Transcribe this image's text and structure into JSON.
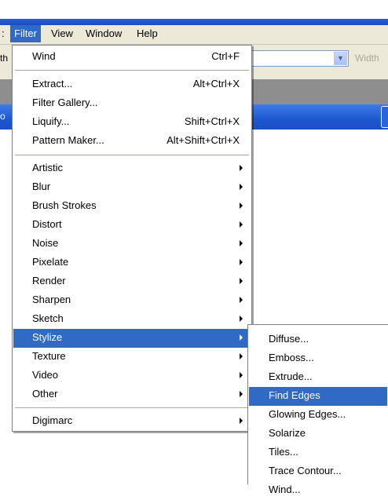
{
  "menubar": {
    "items": [
      {
        "label": ":"
      },
      {
        "label": "Filter"
      },
      {
        "label": "View"
      },
      {
        "label": "Window"
      },
      {
        "label": "Help"
      }
    ]
  },
  "options": {
    "left_partial": "th",
    "width_label": "Width"
  },
  "left_edge_partial": "o",
  "filter_menu": {
    "groups": [
      [
        {
          "label": "Wind",
          "shortcut": "Ctrl+F"
        }
      ],
      [
        {
          "label": "Extract...",
          "shortcut": "Alt+Ctrl+X"
        },
        {
          "label": "Filter Gallery...",
          "shortcut": ""
        },
        {
          "label": "Liquify...",
          "shortcut": "Shift+Ctrl+X"
        },
        {
          "label": "Pattern Maker...",
          "shortcut": "Alt+Shift+Ctrl+X"
        }
      ],
      [
        {
          "label": "Artistic",
          "submenu": true
        },
        {
          "label": "Blur",
          "submenu": true
        },
        {
          "label": "Brush Strokes",
          "submenu": true
        },
        {
          "label": "Distort",
          "submenu": true
        },
        {
          "label": "Noise",
          "submenu": true
        },
        {
          "label": "Pixelate",
          "submenu": true
        },
        {
          "label": "Render",
          "submenu": true
        },
        {
          "label": "Sharpen",
          "submenu": true
        },
        {
          "label": "Sketch",
          "submenu": true
        },
        {
          "label": "Stylize",
          "submenu": true,
          "highlighted": true
        },
        {
          "label": "Texture",
          "submenu": true
        },
        {
          "label": "Video",
          "submenu": true
        },
        {
          "label": "Other",
          "submenu": true
        }
      ],
      [
        {
          "label": "Digimarc",
          "submenu": true
        }
      ]
    ]
  },
  "stylize_submenu": {
    "items": [
      {
        "label": "Diffuse..."
      },
      {
        "label": "Emboss..."
      },
      {
        "label": "Extrude..."
      },
      {
        "label": "Find Edges",
        "highlighted": true
      },
      {
        "label": "Glowing Edges..."
      },
      {
        "label": "Solarize"
      },
      {
        "label": "Tiles..."
      },
      {
        "label": "Trace Contour..."
      },
      {
        "label": "Wind..."
      }
    ]
  },
  "colors": {
    "menu_highlight": "#316ac5",
    "menubar_bg": "#ece9d8",
    "title_blue": "#1f57d0"
  }
}
